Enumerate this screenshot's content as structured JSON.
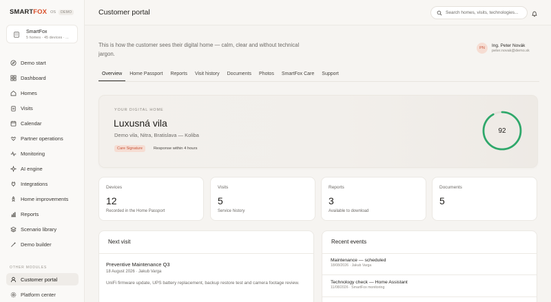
{
  "brand": {
    "name_main": "SMART",
    "name_accent": "FOX",
    "version": "OS",
    "tag": "DEMO",
    "accent_color": "#d9502b"
  },
  "org": {
    "name": "SmartFox",
    "meta": "5 homes · 45 devices · ..."
  },
  "nav": [
    {
      "label": "Demo start",
      "icon": "compass-icon"
    },
    {
      "label": "Dashboard",
      "icon": "grid-icon"
    },
    {
      "label": "Homes",
      "icon": "home-icon"
    },
    {
      "label": "Visits",
      "icon": "clipboard-icon"
    },
    {
      "label": "Calendar",
      "icon": "calendar-icon"
    },
    {
      "label": "Partner operations",
      "icon": "handshake-icon"
    },
    {
      "label": "Monitoring",
      "icon": "pulse-icon"
    },
    {
      "label": "AI engine",
      "icon": "sparkle-icon"
    },
    {
      "label": "Integrations",
      "icon": "plug-icon"
    },
    {
      "label": "Home improvements",
      "icon": "rocket-icon"
    },
    {
      "label": "Reports",
      "icon": "chart-icon"
    },
    {
      "label": "Scenario library",
      "icon": "layers-icon"
    },
    {
      "label": "Demo builder",
      "icon": "wand-icon"
    }
  ],
  "other_modules": {
    "label": "OTHER MODULES",
    "items": [
      {
        "label": "Customer portal",
        "icon": "user-icon",
        "active": true
      },
      {
        "label": "Platform center",
        "icon": "settings-icon"
      }
    ]
  },
  "header": {
    "title": "Customer portal",
    "search_placeholder": "Search homes, visits, technologies..."
  },
  "intro": "This is how the customer sees their digital home — calm, clear and without technical jargon.",
  "user": {
    "initials": "PN",
    "name": "Ing. Peter Novák",
    "email": "peter.novak@demo.sk"
  },
  "tabs": [
    "Overview",
    "Home Passport",
    "Reports",
    "Visit history",
    "Documents",
    "Photos",
    "SmartFox Care",
    "Support"
  ],
  "active_tab": "Overview",
  "hero": {
    "eyebrow": "YOUR DIGITAL HOME",
    "title": "Luxusná vila",
    "subtitle": "Demo vila, Nitra, Bratislava — Koliba",
    "badge": "Care Signature",
    "note": "Response within 4 hours",
    "score": 92,
    "score_max": 100,
    "score_color": "#2fa86b"
  },
  "stats": [
    {
      "label": "Devices",
      "value": "12",
      "note": "Recorded in the Home Passport"
    },
    {
      "label": "Visits",
      "value": "5",
      "note": "Service history"
    },
    {
      "label": "Reports",
      "value": "3",
      "note": "Available to download"
    },
    {
      "label": "Documents",
      "value": "5",
      "note": ""
    }
  ],
  "next_visit": {
    "title": "Next visit",
    "visit_title": "Preventive Maintenance Q3",
    "meta": "18 August 2026 · Jakub Varga",
    "description": "UniFi firmware update, UPS battery replacement, backup restore test and camera footage review."
  },
  "recent_events": {
    "title": "Recent events",
    "items": [
      {
        "title": "Maintenance — scheduled",
        "meta": "18/08/2026 · Jakub Varga"
      },
      {
        "title": "Technology check — Home Assistant",
        "meta": "11/08/2026 · SmartFox monitoring"
      }
    ]
  }
}
